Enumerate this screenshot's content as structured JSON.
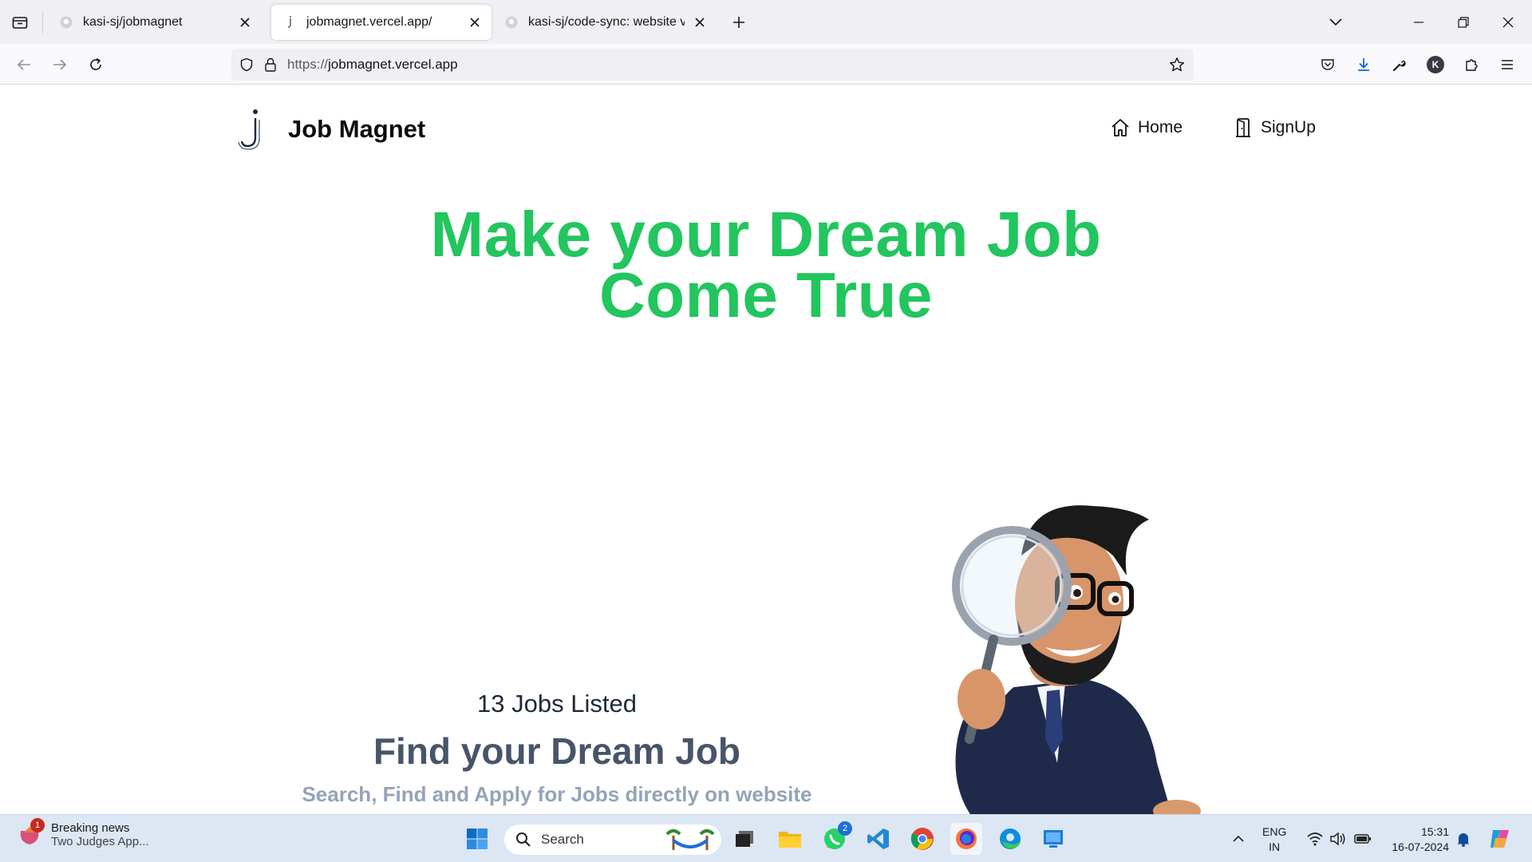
{
  "browser": {
    "tabs": [
      {
        "title": "kasi-sj/jobmagnet",
        "active": false
      },
      {
        "title": "jobmagnet.vercel.app/",
        "active": true
      },
      {
        "title": "kasi-sj/code-sync: website versi",
        "active": false
      }
    ],
    "url_protocol": "https://",
    "url_host": "jobmagnet.vercel.app",
    "profile_initial": "K"
  },
  "site": {
    "brand": "Job Magnet",
    "nav": {
      "home": "Home",
      "signup": "SignUp"
    },
    "hero": {
      "line1": "Make your Dream Job",
      "line2": "Come True"
    },
    "jobs_count": "13 Jobs Listed",
    "find_title": "Find your Dream Job",
    "find_subtitle": "Search, Find and Apply for Jobs directly on website",
    "accent_color": "#22c55e"
  },
  "taskbar": {
    "news_badge": "1",
    "news_title": "Breaking news",
    "news_sub": "Two Judges App...",
    "search_label": "Search",
    "whatsapp_badge": "2",
    "lang_line1": "ENG",
    "lang_line2": "IN",
    "time": "15:31",
    "date": "16-07-2024"
  }
}
